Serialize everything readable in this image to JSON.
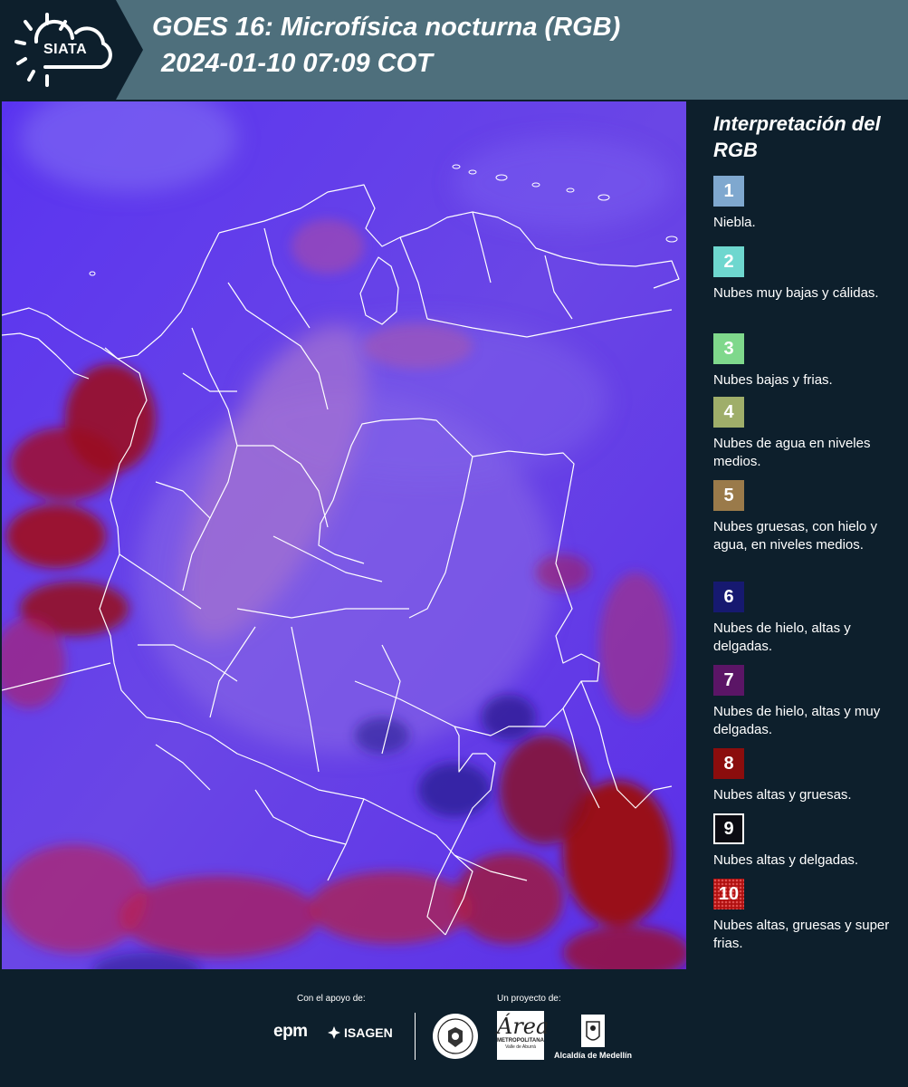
{
  "header": {
    "logo_text": "SIATA",
    "title_line1": "GOES 16: Microfísica nocturna (RGB)",
    "title_line2": "2024-01-10 07:09 COT"
  },
  "map": {
    "description_icon": "satellite-rgb-image-colombia"
  },
  "legend": {
    "title": "Interpretación del RGB",
    "items": [
      {
        "number": "1",
        "color": "#7fa8cf",
        "text": "Niebla."
      },
      {
        "number": "2",
        "color": "#6ed7cf",
        "text": "Nubes muy bajas y cálidas."
      },
      {
        "number": "3",
        "color": "#7fd88c",
        "text": "Nubes bajas y frias."
      },
      {
        "number": "4",
        "color": "#9fae6a",
        "text": "Nubes de agua en niveles medios."
      },
      {
        "number": "5",
        "color": "#9a7a4a",
        "text": "Nubes gruesas, con hielo y agua, en niveles medios."
      },
      {
        "number": "6",
        "color": "#161970",
        "text": "Nubes de hielo, altas y delgadas."
      },
      {
        "number": "7",
        "color": "#5b1566",
        "text": "Nubes de hielo, altas y muy delgadas."
      },
      {
        "number": "8",
        "color": "#8b0d0d",
        "text": "Nubes altas y gruesas."
      },
      {
        "number": "9",
        "color": "#0b0b12",
        "text": "Nubes altas y delgadas."
      },
      {
        "number": "10",
        "color": "#b01010",
        "text": "Nubes altas, gruesas y super frias."
      }
    ]
  },
  "footer": {
    "support_caption": "Con el apoyo de:",
    "project_caption": "Un proyecto de:",
    "epm_label": "epm",
    "isagen_label": "ISAGEN",
    "area_letter": "Área",
    "area_sub1": "METROPOLITANA",
    "area_sub2": "Valle de Aburrá",
    "alcaldia_label": "Alcaldía de Medellín"
  }
}
